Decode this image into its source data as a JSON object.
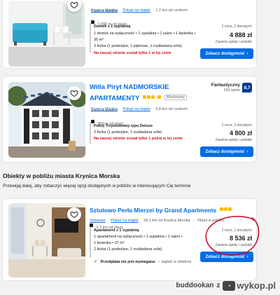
{
  "card1": {
    "links": [
      "Krynica Morska",
      "Pokaż na mapie"
    ],
    "distance": "1,2 km od centrum",
    "beach": "Plaża w pobliżu",
    "beach_distance": "1 000 m od plaży",
    "room_title": "Domek z 1 sypialnią",
    "room_line1": "1 domek na wyłączność • 1 sypialnia • 1 salon • 1 łazienka •",
    "room_line2": "35 m²",
    "room_line3": "3 łóżka (1 podwójne, 1 piętrowe, 1 rozkładana sofa)",
    "warning": "Na naszej stronie został tylko 1 w tej cenie",
    "nights": "2 noce, 2 dorosłych",
    "price": "4 888 zł",
    "price_note": "Zawiera opłaty i podatki",
    "button": "Zobacz dostępność"
  },
  "card2": {
    "title_line1": "Willa Piryt NADMORSKIE",
    "title_line2": "APARTAMENTY",
    "tag": "Wyróżniony",
    "rating_label": "Fantastyczny",
    "reviews": "633 opinie",
    "score": "8,7",
    "links": [
      "Krynica Morska",
      "Pokaż na mapie"
    ],
    "distance": "0,8 km od centrum",
    "beach": "Plaża w pobliżu",
    "beach_distance": "850 m od plaży",
    "room_title": "Pokój Trzyosobowy typu Deluxe",
    "room_line1": "2 łóżka (1 podwójne, 1 rozkładana sofa)",
    "nights": "2 noce, 2 dorosłych",
    "price": "4 800 zł",
    "price_note": "Zawiera opłaty i podatki",
    "warning": "Na naszej stronie został tylko 1 pokój w tej cenie",
    "button": "Zobacz dostępność"
  },
  "section": {
    "title": "Obiekty w pobliżu miasta Krynica Morska",
    "subtitle": "Przewijaj dalej, aby zobaczyć więcej opcji dostępnych w pobliżu w interesującym Cię terminie"
  },
  "card3": {
    "title": "Sztutowo Perła Mierzei by Grand Apartments",
    "links": [
      "Sztutowo",
      "Pokaż na mapie"
    ],
    "distance": "18,1 km od Krynica Morska",
    "beach": "Plaża w pobliżu",
    "beach_distance": "2,3 km od plaży",
    "room_title": "Apartament z 1 sypialnią",
    "room_line1": "1 apartament na wyłączność • 1 sypialnia • 1 salon •",
    "room_line2": "1 łazienka • 37 m²",
    "room_line3": "2 łóżka (1 podwójne, 1 rozkładana sofa)",
    "prepay": "Przedpłata nie jest wymagana",
    "prepay_suffix": "– zapłać w obiekcie",
    "nights": "2 noce, 2 dorosłych",
    "price": "8 536 zł",
    "price_note": "Zawiera opłaty i podatki",
    "button": "Zobacz dostępność"
  },
  "watermark": {
    "author": "buddookan",
    "separator": "z",
    "site": "wykop.pl"
  },
  "colors": {
    "brand_blue": "#006ce4",
    "score_blue": "#003b95",
    "warning_red": "#d4111e",
    "star_yellow": "#febb02",
    "annotation_red": "#c8102e"
  }
}
